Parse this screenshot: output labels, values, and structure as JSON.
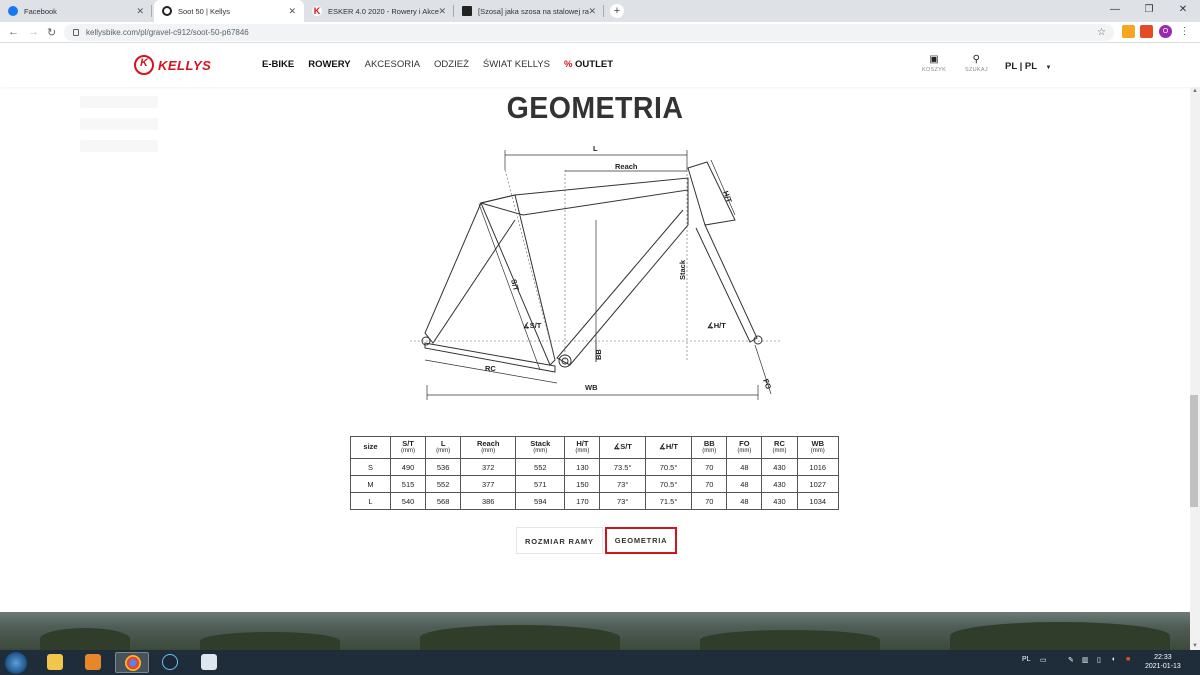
{
  "browser": {
    "tabs": [
      {
        "title": "Facebook",
        "favicon_color": "#1877f2"
      },
      {
        "title": "Soot 50 | Kellys",
        "favicon_color": "#222222"
      },
      {
        "title": "ESKER 4.0 2020 - Rowery i Akce",
        "favicon_color": "#d6121c"
      },
      {
        "title": "[Szosa] jaka szosa na stalowej ra",
        "favicon_color": "#222222"
      }
    ],
    "url": "kellysbike.com/pl/gravel-c912/soot-50-p67846"
  },
  "header": {
    "logo": "KELLYS",
    "nav": [
      "E-BIKE",
      "ROWERY",
      "AKCESORIA",
      "ODZIEŻ",
      "ŚWIAT KELLYS"
    ],
    "outlet_pct": "%",
    "outlet_label": "OUTLET",
    "cart_label": "KOSZYK",
    "search_label": "SZUKAJ",
    "language": "PL | PL"
  },
  "section_title": "GEOMETRIA",
  "diagram_labels": {
    "L": "L",
    "reach": "Reach",
    "ht": "H/T",
    "stack": "Stack",
    "st": "S/T",
    "st_angle": "∡S/T",
    "ht_angle": "∡H/T",
    "bb": "BB",
    "rc": "RC",
    "wb": "WB",
    "fo": "FO"
  },
  "table": {
    "headers": [
      {
        "label": "size",
        "unit": ""
      },
      {
        "label": "S/T",
        "unit": "(mm)"
      },
      {
        "label": "L",
        "unit": "(mm)"
      },
      {
        "label": "Reach",
        "unit": "(mm)"
      },
      {
        "label": "Stack",
        "unit": "(mm)"
      },
      {
        "label": "H/T",
        "unit": "(mm)"
      },
      {
        "label": "∡S/T",
        "unit": ""
      },
      {
        "label": "∡H/T",
        "unit": ""
      },
      {
        "label": "BB",
        "unit": "(mm)"
      },
      {
        "label": "FO",
        "unit": "(mm)"
      },
      {
        "label": "RC",
        "unit": "(mm)"
      },
      {
        "label": "WB",
        "unit": "(mm)"
      }
    ],
    "rows": [
      [
        "S",
        "490",
        "536",
        "372",
        "552",
        "130",
        "73.5°",
        "70.5°",
        "70",
        "48",
        "430",
        "1016"
      ],
      [
        "M",
        "515",
        "552",
        "377",
        "571",
        "150",
        "73°",
        "70.5°",
        "70",
        "48",
        "430",
        "1027"
      ],
      [
        "L",
        "540",
        "568",
        "386",
        "594",
        "170",
        "73°",
        "71.5°",
        "70",
        "48",
        "430",
        "1034"
      ]
    ]
  },
  "buttons": {
    "frame_size": "ROZMIAR RAMY",
    "geometry": "GEOMETRIA"
  },
  "taskbar": {
    "lang": "PL",
    "time": "22:33",
    "date": "2021-01-13"
  }
}
